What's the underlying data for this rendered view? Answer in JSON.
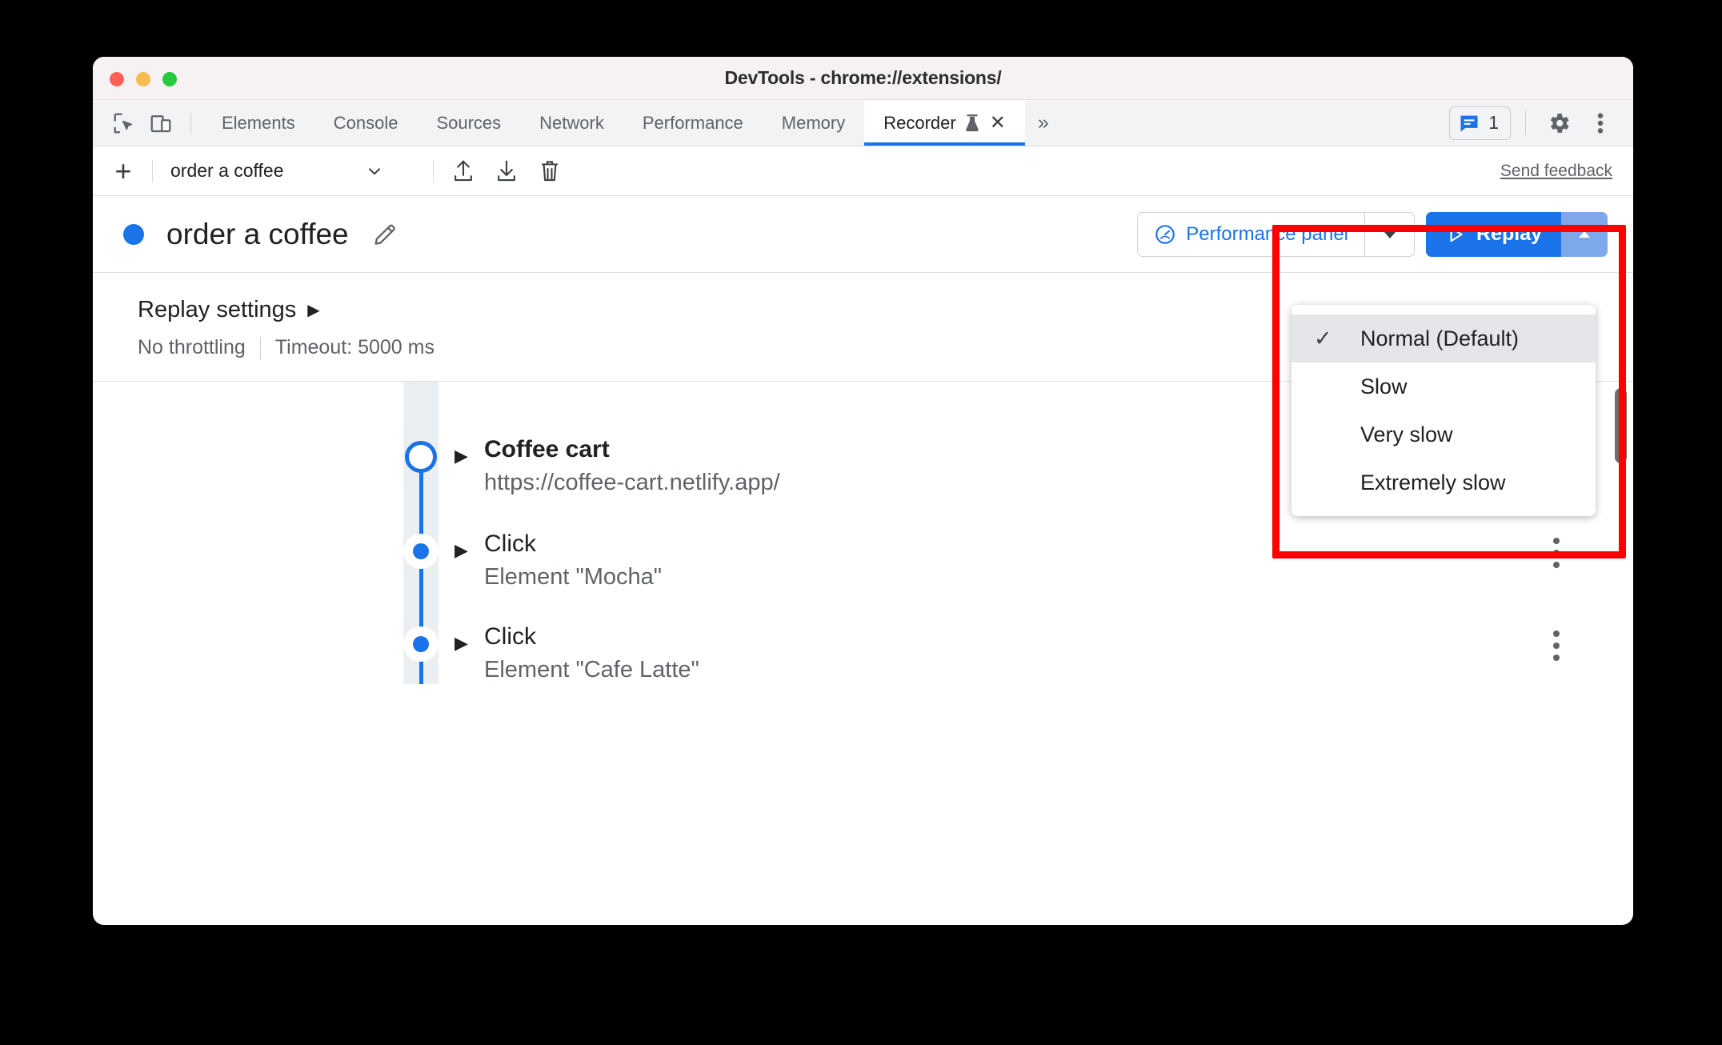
{
  "window": {
    "title": "DevTools - chrome://extensions/",
    "traffic_lights": [
      "close",
      "minimize",
      "zoom"
    ]
  },
  "devtools_tabbar": {
    "left_icons": [
      {
        "name": "inspect-element-icon",
        "label": "Inspect element"
      },
      {
        "name": "device-toolbar-icon",
        "label": "Toggle device toolbar"
      }
    ],
    "tabs": [
      {
        "label": "Elements",
        "active": false
      },
      {
        "label": "Console",
        "active": false
      },
      {
        "label": "Sources",
        "active": false
      },
      {
        "label": "Network",
        "active": false
      },
      {
        "label": "Performance",
        "active": false
      },
      {
        "label": "Memory",
        "active": false
      },
      {
        "label": "Recorder",
        "active": true,
        "experimental": true,
        "closeable": true
      }
    ],
    "more_tabs_label": "»",
    "messages": {
      "icon": "message-icon",
      "count": "1"
    },
    "settings_icon": "gear-icon",
    "more_options_icon": "kebab-menu-icon"
  },
  "recorder_toolbar": {
    "add_label": "+",
    "selected_recording": "order a coffee",
    "dropdown_icon": "chevron-down-icon",
    "import_icon": "import-icon",
    "export_icon": "export-icon",
    "delete_icon": "trash-icon",
    "send_feedback": "Send feedback"
  },
  "recording_header": {
    "status_color": "#1a73e8",
    "title": "order a coffee",
    "edit_icon": "pencil-icon",
    "performance_panel": {
      "label": "Performance panel",
      "icon": "speedometer-icon",
      "dropdown_icon": "chevron-down-icon",
      "text_color": "#1a73e8"
    },
    "replay": {
      "label": "Replay",
      "play_icon": "play-triangle-icon",
      "dropdown_icon": "chevron-up-icon",
      "bg_color": "#1a73e8",
      "dropdown_bg_color": "#7da9ec"
    }
  },
  "replay_settings": {
    "title": "Replay settings",
    "caret": "▶",
    "throttling": "No throttling",
    "timeout": "Timeout: 5000 ms"
  },
  "speed_menu": {
    "items": [
      {
        "label": "Normal (Default)",
        "checked": true
      },
      {
        "label": "Slow",
        "checked": false
      },
      {
        "label": "Very slow",
        "checked": false
      },
      {
        "label": "Extremely slow",
        "checked": false
      }
    ],
    "check_glyph": "✓"
  },
  "steps": [
    {
      "title": "Coffee cart",
      "subtitle": "https://coffee-cart.netlify.app/",
      "marker": "start",
      "caret": "▶",
      "bold_title": true
    },
    {
      "title": "Click",
      "subtitle": "Element \"Mocha\"",
      "marker": "dot",
      "caret": "▶",
      "bold_title": false
    },
    {
      "title": "Click",
      "subtitle": "Element \"Cafe Latte\"",
      "marker": "dot",
      "caret": "▶",
      "bold_title": false
    }
  ],
  "annotation": {
    "color": "#ff0000",
    "target": "replay-speed-dropdown"
  }
}
